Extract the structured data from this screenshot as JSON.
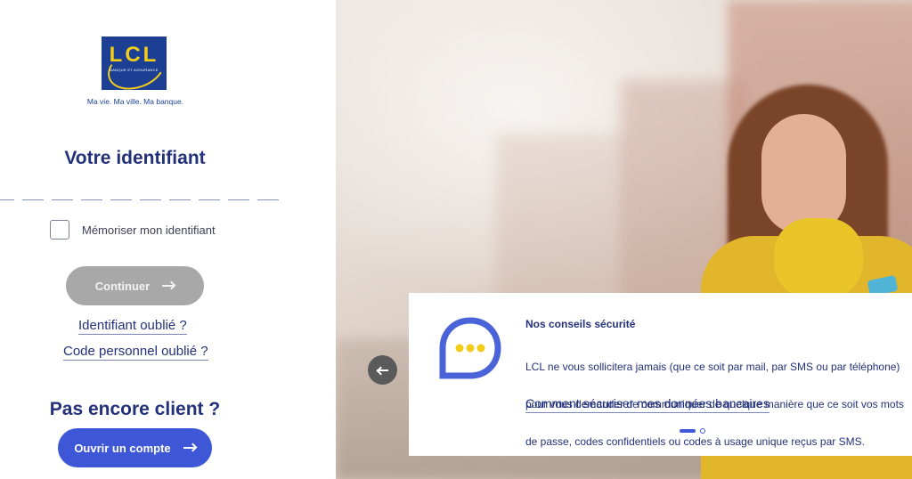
{
  "logo": {
    "text": "LCL",
    "subtext": "BANQUE ET ASSURANCE",
    "tagline": "Ma vie. Ma ville. Ma banque."
  },
  "login": {
    "title": "Votre identifiant",
    "digit_count": 10,
    "remember_label": "Mémoriser mon identifiant",
    "remember_checked": false,
    "continue_label": "Continuer",
    "forgot_id_link": "Identifiant oublié ?",
    "forgot_code_link": "Code personnel oublié ?"
  },
  "signup": {
    "title": "Pas encore client ?",
    "open_account_label": "Ouvrir un compte"
  },
  "carousel": {
    "card_title": "Nos conseils sécurité",
    "card_text_line1": "LCL ne vous sollicitera jamais (que ce soit par mail, par SMS ou par téléphone)",
    "card_text_line2": "pour vous demander de communiquer de quelque manière que ce soit vos mots",
    "card_text_line3": "de passe, codes confidentiels ou codes à usage unique reçus par SMS.",
    "card_link": "Comment sécuriser mes données bancaires",
    "slide_count": 2,
    "active_slide": 1
  },
  "colors": {
    "brand_blue": "#1c3f94",
    "brand_yellow": "#f4cc1a",
    "heading": "#23317a",
    "primary_button": "#3e57d6",
    "disabled_button": "#a8a8a8"
  },
  "icons": {
    "continue_arrow": "arrow-right-icon",
    "open_arrow": "arrow-right-icon",
    "prev_arrow": "arrow-left-icon",
    "chat": "chat-bubble-icon"
  }
}
